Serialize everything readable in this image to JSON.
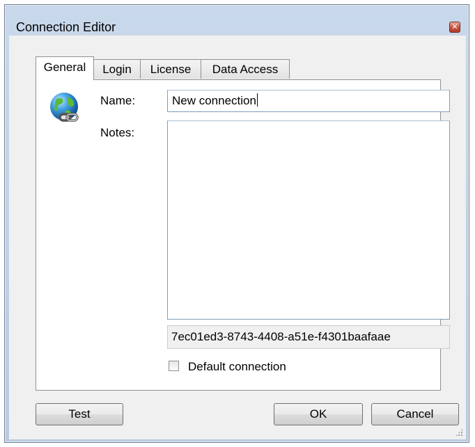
{
  "window": {
    "title": "Connection Editor",
    "close_glyph": "✕"
  },
  "tabs": [
    {
      "label": "General",
      "active": true
    },
    {
      "label": "Login",
      "active": false
    },
    {
      "label": "License",
      "active": false
    },
    {
      "label": "Data Access",
      "active": false
    }
  ],
  "general": {
    "icon": "globe-connection-icon",
    "name_label": "Name:",
    "name_value": "New connection",
    "notes_label": "Notes:",
    "notes_value": "",
    "connection_id": "7ec01ed3-8743-4408-a51e-f4301baafaae",
    "default_checkbox_label": "Default connection",
    "default_checked": false
  },
  "buttons": {
    "test": "Test",
    "ok": "OK",
    "cancel": "Cancel"
  },
  "colors": {
    "frame": "#c4d5ea",
    "client": "#f0f0f0",
    "close_button": "#c8513f"
  }
}
